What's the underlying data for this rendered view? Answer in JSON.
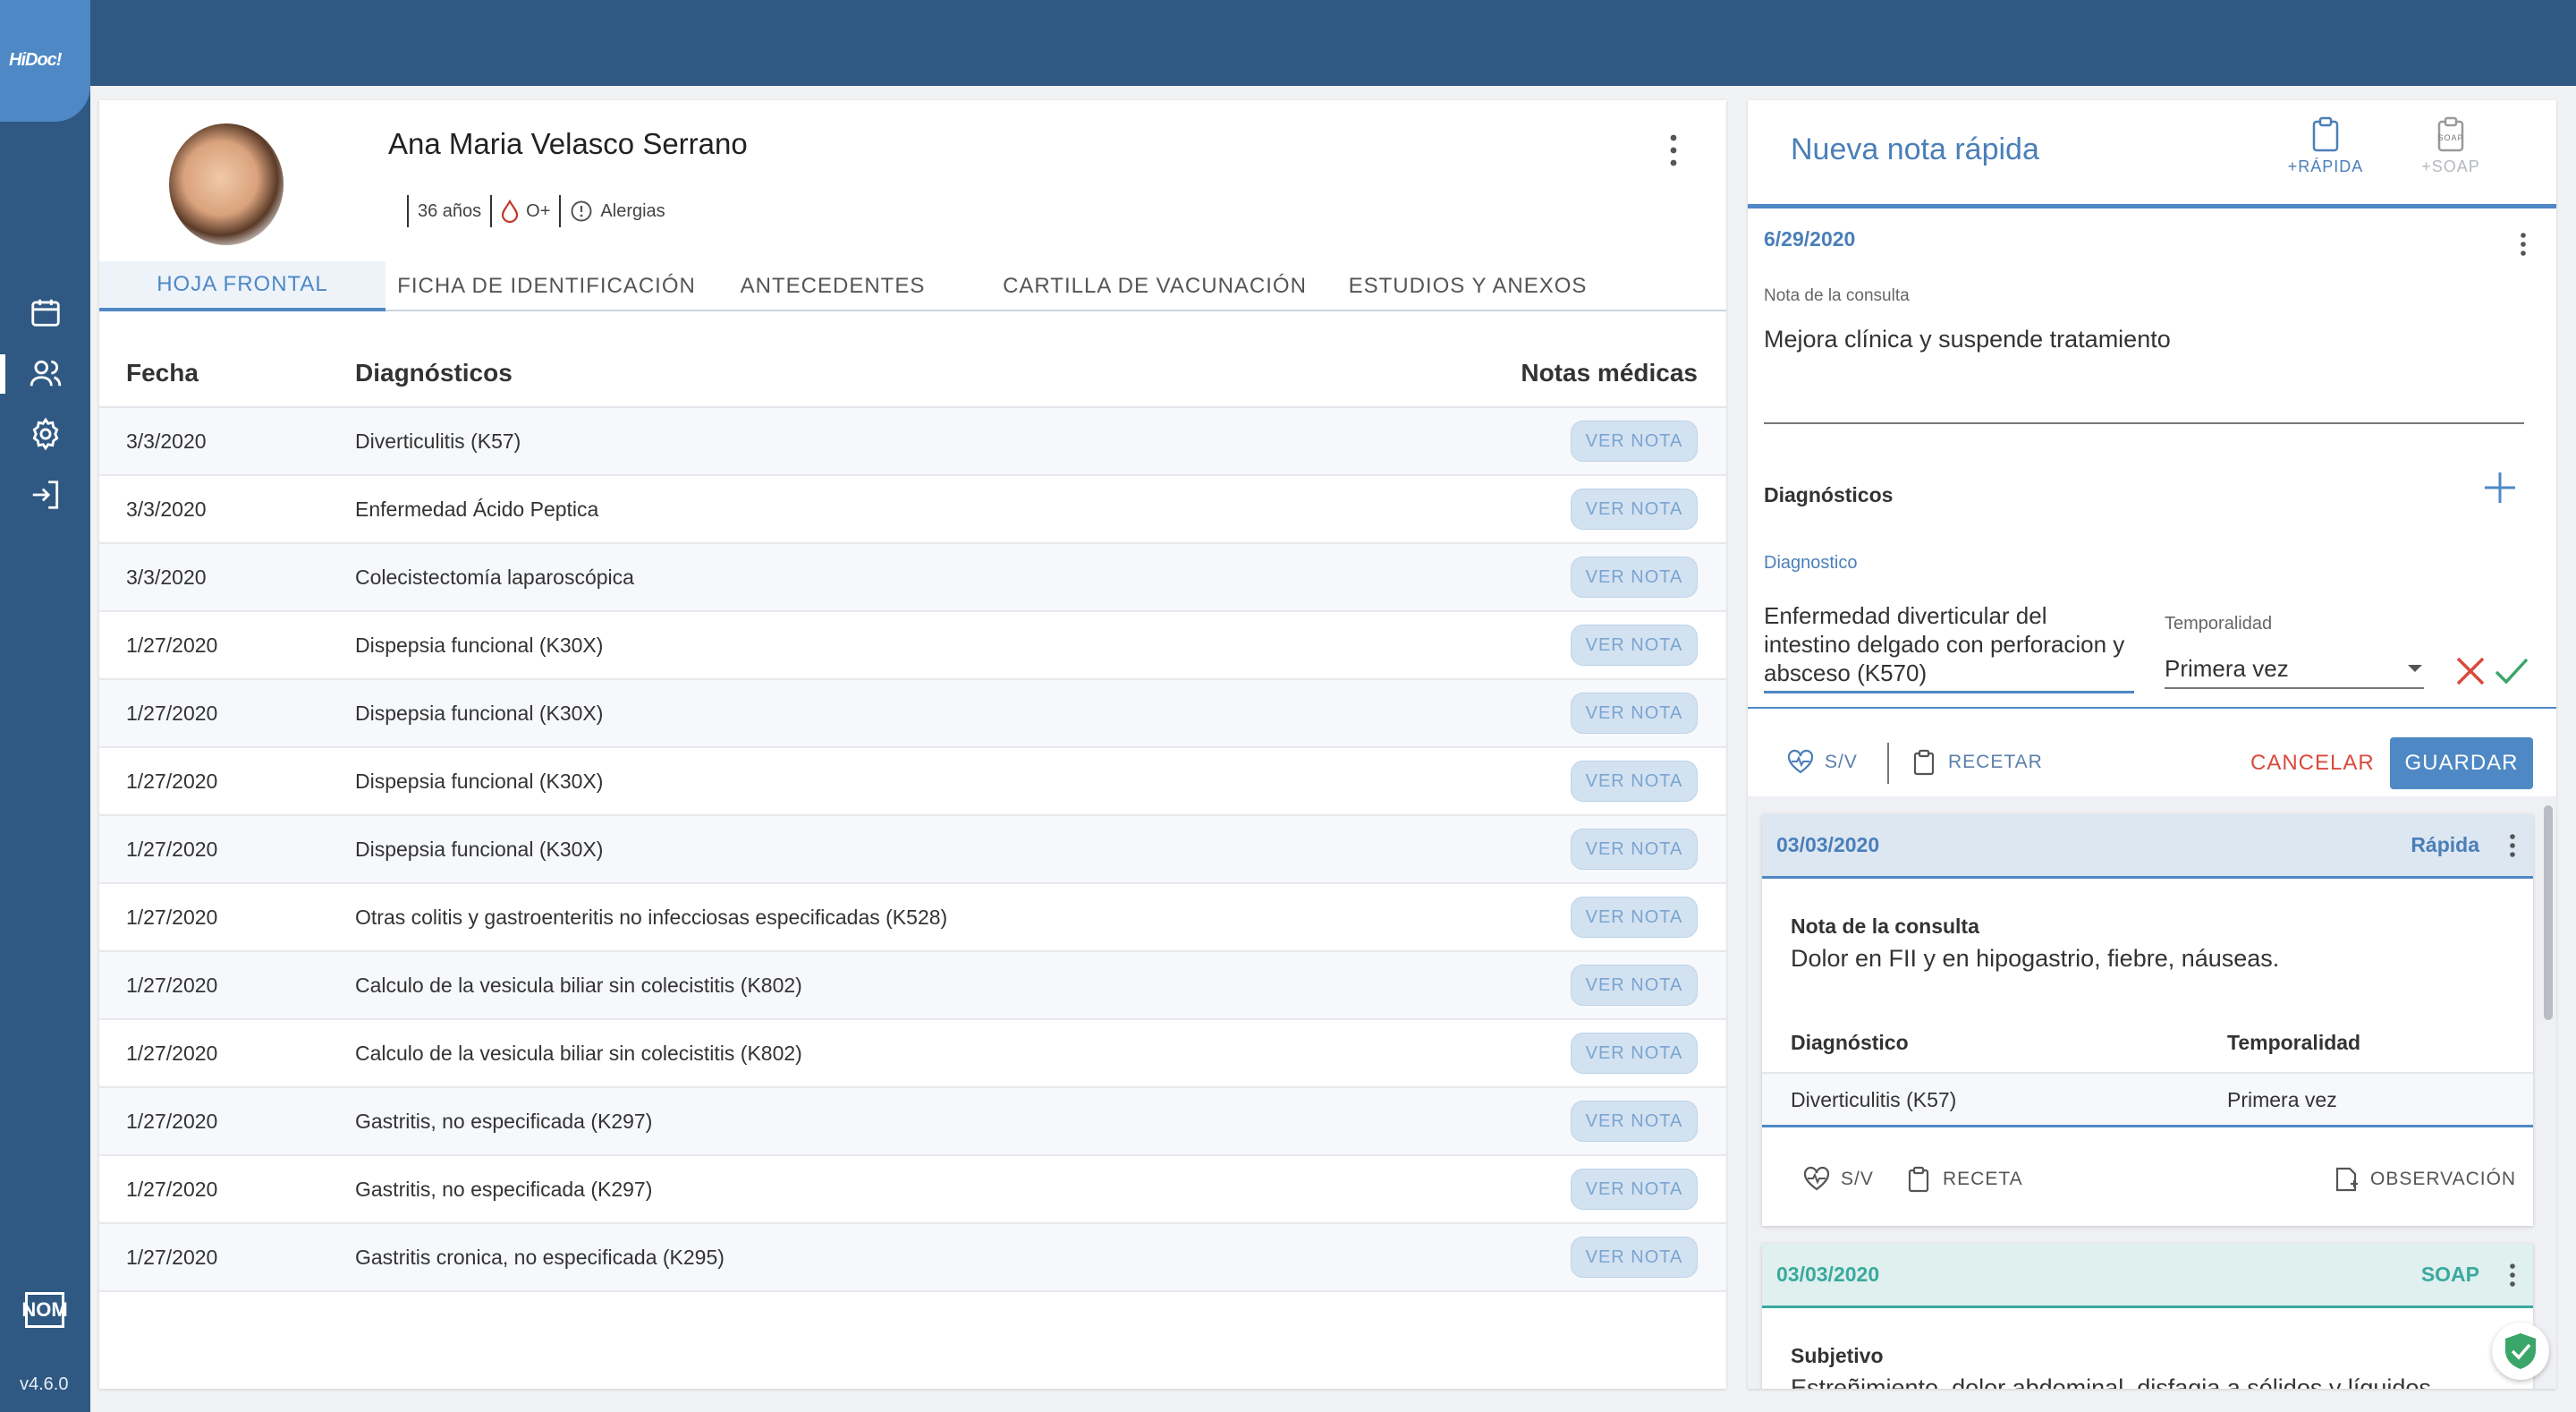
{
  "app": {
    "logo_text": "HiDoc!",
    "version": "v4.6.0",
    "nom_label": "NOM"
  },
  "patient": {
    "name": "Ana Maria Velasco Serrano",
    "age": "36 años",
    "blood_type": "O+",
    "allergies": "Alergias"
  },
  "tabs": [
    {
      "label": "HOJA FRONTAL"
    },
    {
      "label": "FICHA DE IDENTIFICACIÓN"
    },
    {
      "label": "ANTECEDENTES"
    },
    {
      "label": "CARTILLA DE VACUNACIÓN"
    },
    {
      "label": "ESTUDIOS Y ANEXOS"
    }
  ],
  "table": {
    "headers": {
      "date": "Fecha",
      "diagnoses": "Diagnósticos",
      "notes": "Notas médicas"
    },
    "button_label": "VER NOTA",
    "rows": [
      {
        "date": "3/3/2020",
        "diagnosis": "Diverticulitis (K57)"
      },
      {
        "date": "3/3/2020",
        "diagnosis": "Enfermedad Ácido Peptica"
      },
      {
        "date": "3/3/2020",
        "diagnosis": "Colecistectomía laparoscópica"
      },
      {
        "date": "1/27/2020",
        "diagnosis": "Dispepsia funcional (K30X)"
      },
      {
        "date": "1/27/2020",
        "diagnosis": "Dispepsia funcional (K30X)"
      },
      {
        "date": "1/27/2020",
        "diagnosis": "Dispepsia funcional (K30X)"
      },
      {
        "date": "1/27/2020",
        "diagnosis": "Dispepsia funcional (K30X)"
      },
      {
        "date": "1/27/2020",
        "diagnosis": "Otras colitis y gastroenteritis no infecciosas especificadas (K528)"
      },
      {
        "date": "1/27/2020",
        "diagnosis": "Calculo de la vesicula biliar sin colecistitis (K802)"
      },
      {
        "date": "1/27/2020",
        "diagnosis": "Calculo de la vesicula biliar sin colecistitis (K802)"
      },
      {
        "date": "1/27/2020",
        "diagnosis": "Gastritis, no especificada (K297)"
      },
      {
        "date": "1/27/2020",
        "diagnosis": "Gastritis, no especificada (K297)"
      },
      {
        "date": "1/27/2020",
        "diagnosis": "Gastritis cronica, no especificada (K295)"
      }
    ]
  },
  "quick_note": {
    "title": "Nueva nota rápida",
    "btn_rapida": "+RÁPIDA",
    "btn_soap": "+SOAP",
    "soap_icon_text": "SOAP",
    "date": "6/29/2020",
    "nota_label": "Nota de la consulta",
    "nota_value": "Mejora clínica y suspende tratamiento",
    "diagnosticos_title": "Diagnósticos",
    "diagnostico_label": "Diagnostico",
    "diagnostico_value": "Enfermedad diverticular del intestino delgado con perforacion y absceso (K570)",
    "temporalidad_label": "Temporalidad",
    "temporalidad_value": "Primera vez",
    "sv_label": "S/V",
    "recetar_label": "RECETAR",
    "cancel_label": "CANCELAR",
    "save_label": "GUARDAR"
  },
  "history": [
    {
      "date": "03/03/2020",
      "type": "Rápida",
      "nota_label": "Nota de la consulta",
      "nota_text": "Dolor en FII y en hipogastrio, fiebre, náuseas.",
      "diag_header": "Diagnóstico",
      "temp_header": "Temporalidad",
      "diag_value": "Diverticulitis (K57)",
      "temp_value": "Primera vez",
      "sv_label": "S/V",
      "receta_label": "RECETA",
      "observacion_label": "OBSERVACIÓN"
    },
    {
      "date": "03/03/2020",
      "type": "SOAP",
      "subjetivo_label": "Subjetivo",
      "subjetivo_text": "Estreñimiento, dolor abdominal, disfagia a sólidos y líquidos,"
    }
  ],
  "colors": {
    "primary": "#4e88c5",
    "sidebar": "#2f5983",
    "soap_accent": "#3aa99f",
    "cancel": "#d94a3c"
  }
}
